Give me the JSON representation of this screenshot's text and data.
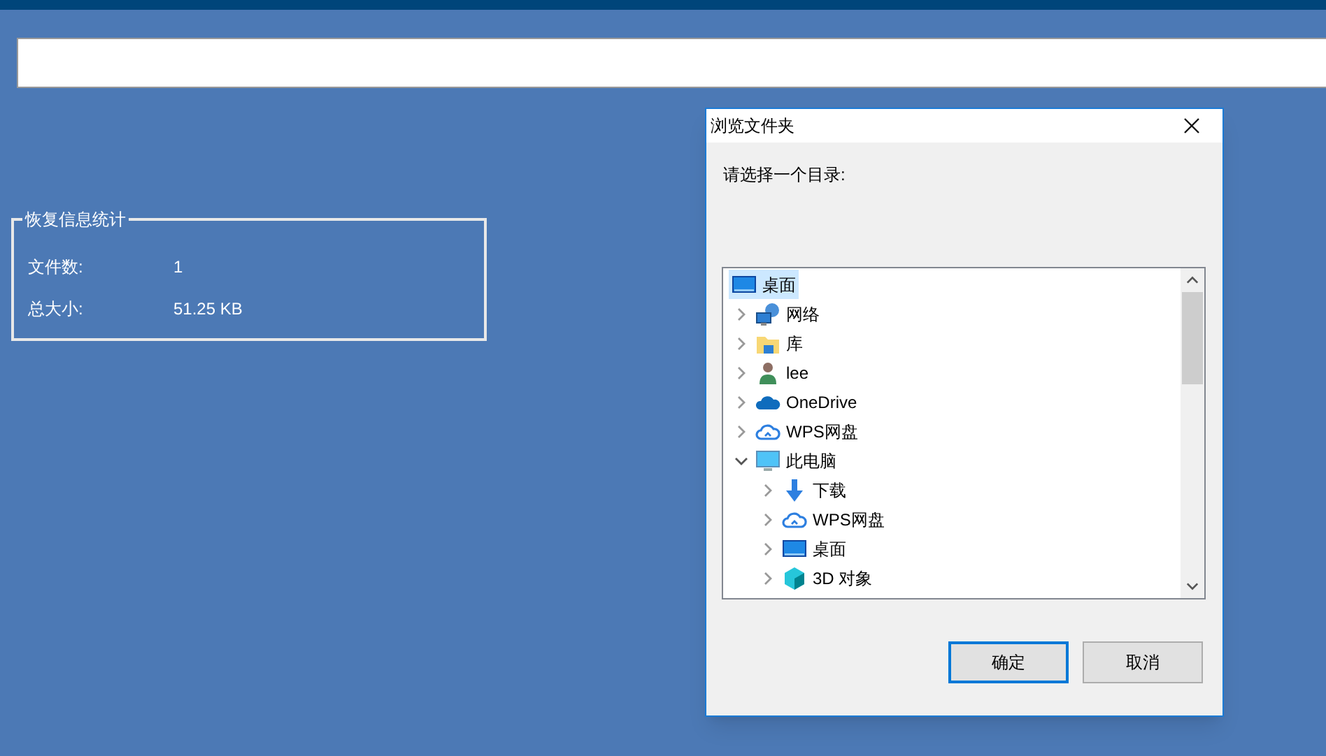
{
  "stats_group": {
    "title": "恢复信息统计",
    "rows": [
      {
        "label": "文件数:",
        "value": "1"
      },
      {
        "label": "总大小:",
        "value": "51.25 KB"
      }
    ]
  },
  "dialog": {
    "title": "浏览文件夹",
    "prompt": "请选择一个目录:",
    "tree": [
      {
        "label": "桌面",
        "kind": "desktop",
        "selected": true,
        "children": [
          {
            "label": "网络",
            "kind": "network",
            "selected": false,
            "expanded": false
          },
          {
            "label": "库",
            "kind": "library",
            "selected": false,
            "expanded": false
          },
          {
            "label": "lee",
            "kind": "user",
            "selected": false,
            "expanded": false
          },
          {
            "label": "OneDrive",
            "kind": "onedrive",
            "selected": false,
            "expanded": false
          },
          {
            "label": "WPS网盘",
            "kind": "cloud",
            "selected": false,
            "expanded": false
          },
          {
            "label": "此电脑",
            "kind": "pc",
            "selected": false,
            "expanded": true,
            "children": [
              {
                "label": "下载",
                "kind": "download",
                "selected": false,
                "expanded": false
              },
              {
                "label": "WPS网盘",
                "kind": "cloud",
                "selected": false,
                "expanded": false
              },
              {
                "label": "桌面",
                "kind": "desktop",
                "selected": false,
                "expanded": false
              },
              {
                "label": "3D 对象",
                "kind": "cube",
                "selected": false,
                "expanded": false
              }
            ]
          }
        ]
      }
    ],
    "buttons": [
      {
        "label": "确定",
        "default": true
      },
      {
        "label": "取消",
        "default": false
      }
    ]
  }
}
